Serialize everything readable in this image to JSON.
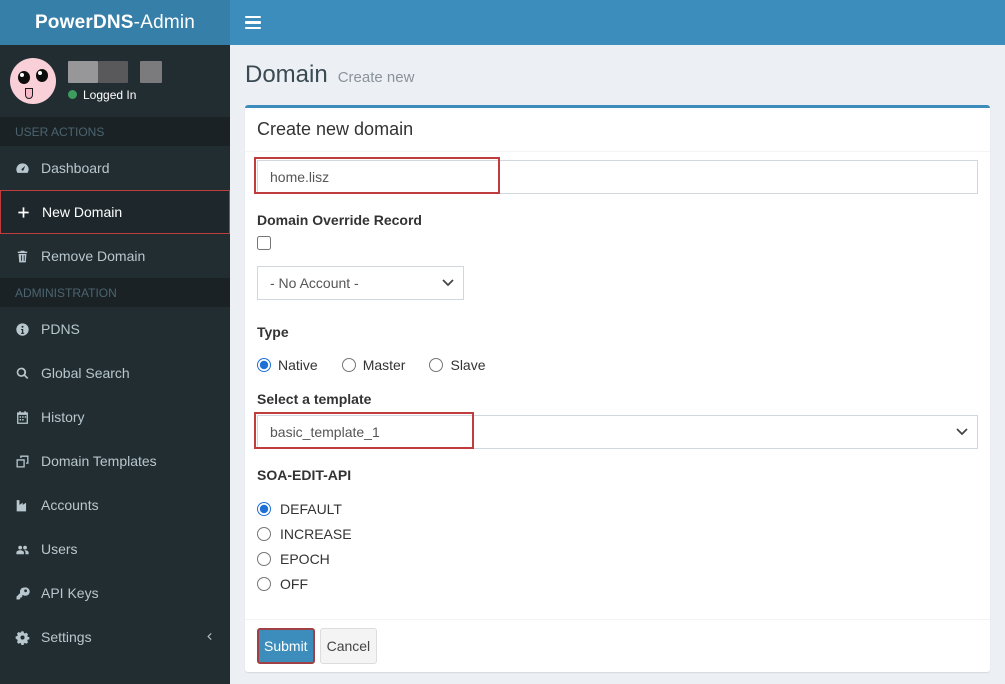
{
  "colors": {
    "navbar": "#3c8dbc",
    "logo_bg": "#367fa9",
    "sidebar_bg": "#222d32",
    "sidebar_section_bg": "#1a2226",
    "sidebar_text": "#b8c7ce",
    "sidebar_section_text": "#4b646f",
    "sidebar_active_bg": "#1e282c",
    "content_bg": "#ecf0f5",
    "panel_top_border": "#3c8dbc",
    "annotation_red": "#c13c3c",
    "primary_button": "#3c8dbc",
    "status_green": "#3c9d5f",
    "radio_accent": "#1f6fd6"
  },
  "header": {
    "logo_bold": "PowerDNS",
    "logo_light": "-Admin"
  },
  "sidebar": {
    "user": {
      "status": "Logged In"
    },
    "sections": [
      {
        "label": "USER ACTIONS",
        "items": [
          {
            "label": "Dashboard",
            "icon": "dashboard-icon",
            "active": false
          },
          {
            "label": "New Domain",
            "icon": "plus-icon",
            "active": true
          },
          {
            "label": "Remove Domain",
            "icon": "trash-icon",
            "active": false
          }
        ]
      },
      {
        "label": "ADMINISTRATION",
        "items": [
          {
            "label": "PDNS",
            "icon": "info-circle-icon",
            "active": false
          },
          {
            "label": "Global Search",
            "icon": "search-icon",
            "active": false
          },
          {
            "label": "History",
            "icon": "calendar-icon",
            "active": false
          },
          {
            "label": "Domain Templates",
            "icon": "clone-icon",
            "active": false
          },
          {
            "label": "Accounts",
            "icon": "industry-icon",
            "active": false
          },
          {
            "label": "Users",
            "icon": "users-icon",
            "active": false
          },
          {
            "label": "API Keys",
            "icon": "key-icon",
            "active": false
          },
          {
            "label": "Settings",
            "icon": "gear-icon",
            "active": false,
            "trailing_icon": "chevron-left-icon"
          }
        ]
      }
    ]
  },
  "main": {
    "page_title": "Domain",
    "page_subtitle": "Create new",
    "panel": {
      "title": "Create new domain",
      "domain_input": {
        "value": "home.lisz"
      },
      "override_label": "Domain Override Record",
      "override_checked": false,
      "account_select": {
        "value": "- No Account -"
      },
      "type_label": "Type",
      "type_options": [
        {
          "label": "Native",
          "selected": true
        },
        {
          "label": "Master",
          "selected": false
        },
        {
          "label": "Slave",
          "selected": false
        }
      ],
      "template_label": "Select a template",
      "template_select": {
        "value": "basic_template_1"
      },
      "soa_label": "SOA-EDIT-API",
      "soa_options": [
        {
          "label": "DEFAULT",
          "selected": true
        },
        {
          "label": "INCREASE",
          "selected": false
        },
        {
          "label": "EPOCH",
          "selected": false
        },
        {
          "label": "OFF",
          "selected": false
        }
      ],
      "submit_label": "Submit",
      "cancel_label": "Cancel"
    }
  },
  "annotations": {
    "highlighted_elements": [
      "new-domain-menu-item",
      "domain-name-input",
      "template-select",
      "submit-button"
    ]
  }
}
